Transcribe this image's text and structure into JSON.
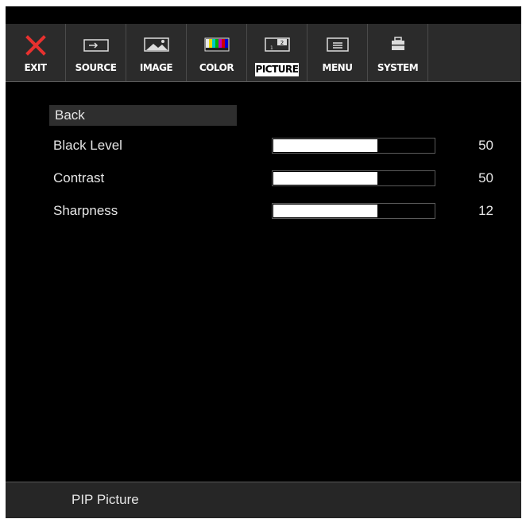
{
  "tabs": [
    {
      "label": "EXIT",
      "icon": "close-icon"
    },
    {
      "label": "SOURCE",
      "icon": "input-source-icon"
    },
    {
      "label": "IMAGE",
      "icon": "image-icon"
    },
    {
      "label": "COLOR",
      "icon": "color-bars-icon"
    },
    {
      "label": "PICTURE",
      "icon": "pip-icon"
    },
    {
      "label": "MENU",
      "icon": "menu-icon"
    },
    {
      "label": "SYSTEM",
      "icon": "briefcase-icon"
    }
  ],
  "active_tab": "PICTURE",
  "back_label": "Back",
  "settings": [
    {
      "label": "Black Level",
      "value": "50",
      "level": 0.65
    },
    {
      "label": "Contrast",
      "value": "50",
      "level": 0.65
    },
    {
      "label": "Sharpness",
      "value": "12",
      "level": 0.65
    }
  ],
  "footer": {
    "label": "PIP Picture"
  },
  "colors": {
    "accent_exit": "#e8312f",
    "fill": "#ffffff",
    "background": "#000000"
  }
}
